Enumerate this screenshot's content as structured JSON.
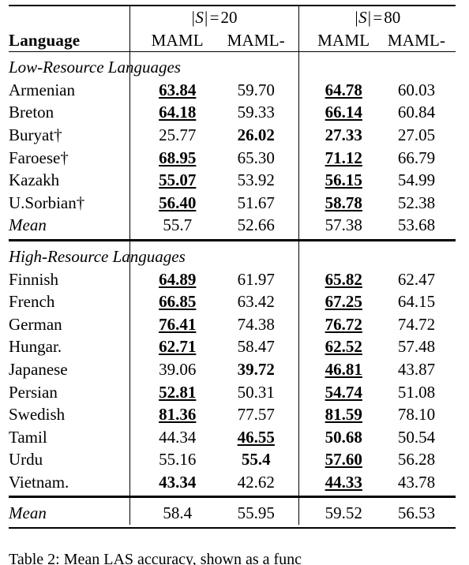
{
  "table": {
    "corner_header": "Language",
    "groups": [
      {
        "label_prefix": "|S|",
        "label_eq": "=",
        "label_value": "20"
      },
      {
        "label_prefix": "|S|",
        "label_eq": "=",
        "label_value": "80"
      }
    ],
    "column_headers": [
      "MAML",
      "MAML-",
      "MAML",
      "MAML-"
    ],
    "sections": [
      {
        "title": "Low-Resource Languages",
        "rows": [
          {
            "language": "Armenian",
            "values": [
              "63.84",
              "59.70",
              "64.78",
              "60.03"
            ],
            "styles": [
              "bu",
              "",
              "bu",
              ""
            ]
          },
          {
            "language": "Breton",
            "values": [
              "64.18",
              "59.33",
              "66.14",
              "60.84"
            ],
            "styles": [
              "bu",
              "",
              "bu",
              ""
            ]
          },
          {
            "language": "Buryat†",
            "values": [
              "25.77",
              "26.02",
              "27.33",
              "27.05"
            ],
            "styles": [
              "",
              "b",
              "b",
              ""
            ]
          },
          {
            "language": "Faroese†",
            "values": [
              "68.95",
              "65.30",
              "71.12",
              "66.79"
            ],
            "styles": [
              "bu",
              "",
              "bu",
              ""
            ]
          },
          {
            "language": "Kazakh",
            "values": [
              "55.07",
              "53.92",
              "56.15",
              "54.99"
            ],
            "styles": [
              "bu",
              "",
              "bu",
              ""
            ]
          },
          {
            "language": "U.Sorbian†",
            "values": [
              "56.40",
              "51.67",
              "58.78",
              "52.38"
            ],
            "styles": [
              "bu",
              "",
              "bu",
              ""
            ]
          }
        ],
        "mean": {
          "language": "Mean",
          "values": [
            "55.7",
            "52.66",
            "57.38",
            "53.68"
          ],
          "styles": [
            "",
            "",
            "",
            ""
          ]
        }
      },
      {
        "title": "High-Resource Languages",
        "rows": [
          {
            "language": "Finnish",
            "values": [
              "64.89",
              "61.97",
              "65.82",
              "62.47"
            ],
            "styles": [
              "bu",
              "",
              "bu",
              ""
            ]
          },
          {
            "language": "French",
            "values": [
              "66.85",
              "63.42",
              "67.25",
              "64.15"
            ],
            "styles": [
              "bu",
              "",
              "bu",
              ""
            ]
          },
          {
            "language": "German",
            "values": [
              "76.41",
              "74.38",
              "76.72",
              "74.72"
            ],
            "styles": [
              "bu",
              "",
              "bu",
              ""
            ]
          },
          {
            "language": "Hungar.",
            "values": [
              "62.71",
              "58.47",
              "62.52",
              "57.48"
            ],
            "styles": [
              "bu",
              "",
              "bu",
              ""
            ]
          },
          {
            "language": "Japanese",
            "values": [
              "39.06",
              "39.72",
              "46.81",
              "43.87"
            ],
            "styles": [
              "",
              "b",
              "bu",
              ""
            ]
          },
          {
            "language": "Persian",
            "values": [
              "52.81",
              "50.31",
              "54.74",
              "51.08"
            ],
            "styles": [
              "bu",
              "",
              "bu",
              ""
            ]
          },
          {
            "language": "Swedish",
            "values": [
              "81.36",
              "77.57",
              "81.59",
              "78.10"
            ],
            "styles": [
              "bu",
              "",
              "bu",
              ""
            ]
          },
          {
            "language": "Tamil",
            "values": [
              "44.34",
              "46.55",
              "50.68",
              "50.54"
            ],
            "styles": [
              "",
              "bu",
              "b",
              ""
            ]
          },
          {
            "language": "Urdu",
            "values": [
              "55.16",
              "55.4",
              "57.60",
              "56.28"
            ],
            "styles": [
              "",
              "b",
              "bu",
              ""
            ]
          },
          {
            "language": "Vietnam.",
            "values": [
              "43.34",
              "42.62",
              "44.33",
              "43.78"
            ],
            "styles": [
              "b",
              "",
              "bu",
              ""
            ]
          }
        ],
        "mean": null
      }
    ],
    "overall_mean": {
      "language": "Mean",
      "values": [
        "58.4",
        "55.95",
        "59.52",
        "56.53"
      ],
      "styles": [
        "",
        "",
        "",
        ""
      ]
    }
  },
  "caption": {
    "text": "Table 2: Mean LAS accuracy, shown as a func"
  }
}
